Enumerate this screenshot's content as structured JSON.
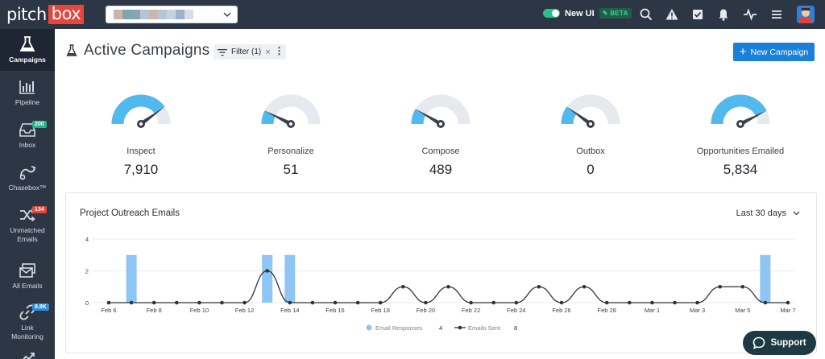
{
  "app": {
    "logo_part1": "pitch",
    "logo_part2": "box"
  },
  "header": {
    "new_ui_label": "New UI",
    "beta_label": "BETA",
    "project_swatches": [
      "#c9b6a8",
      "#7fa6ad",
      "#8aa3b8",
      "#b9c3d3",
      "#c8b8ae",
      "#b6c6d3",
      "#c5d2de",
      "#9fb1c6",
      "#d6dde6"
    ]
  },
  "sidebar": {
    "items": [
      {
        "label": "Campaigns",
        "icon": "flask-icon",
        "active": true
      },
      {
        "label": "Pipeline",
        "icon": "bar-chart-icon"
      },
      {
        "label": "Inbox",
        "icon": "inbox-icon",
        "badge": "200",
        "badge_color": "#27b48a"
      },
      {
        "label": "Chasebox™",
        "icon": "chasebox-icon"
      },
      {
        "label": "Unmatched Emails",
        "icon": "shuffle-icon",
        "badge": "134",
        "badge_color": "#e8453c"
      },
      {
        "label": "All Emails",
        "icon": "envelopes-icon"
      },
      {
        "label": "Link Monitoring",
        "icon": "link-icon",
        "badge": "8.8K",
        "badge_color": "#2e8fd8"
      }
    ]
  },
  "page": {
    "title": "Active Campaigns",
    "filter_label": "Filter (1)",
    "new_campaign_label": "New Campaign"
  },
  "gauges": [
    {
      "label": "Inspect",
      "value": "7,910",
      "level": 0.8
    },
    {
      "label": "Personalize",
      "value": "51",
      "level": 0.15
    },
    {
      "label": "Compose",
      "value": "489",
      "level": 0.17
    },
    {
      "label": "Outbox",
      "value": "0",
      "level": 0.2
    },
    {
      "label": "Opportunities Emailed",
      "value": "5,834",
      "level": 0.85
    }
  ],
  "outreach": {
    "title": "Project Outreach Emails",
    "range_label": "Last 30 days"
  },
  "chart_data": {
    "type": "bar",
    "title": "Project Outreach Emails",
    "x": [
      "Feb 6",
      "Feb 7",
      "Feb 8",
      "Feb 9",
      "Feb 10",
      "Feb 11",
      "Feb 12",
      "Feb 13",
      "Feb 14",
      "Feb 15",
      "Feb 16",
      "Feb 17",
      "Feb 18",
      "Feb 19",
      "Feb 20",
      "Feb 21",
      "Feb 22",
      "Feb 23",
      "Feb 24",
      "Feb 25",
      "Feb 26",
      "Feb 27",
      "Feb 28",
      "Feb 29",
      "Mar 1",
      "Mar 2",
      "Mar 3",
      "Mar 4",
      "Mar 5",
      "Mar 6",
      "Mar 7"
    ],
    "x_tick_labels": [
      "Feb 6",
      "Feb 8",
      "Feb 10",
      "Feb 12",
      "Feb 14",
      "Feb 16",
      "Feb 18",
      "Feb 20",
      "Feb 22",
      "Feb 24",
      "Feb 26",
      "Feb 28",
      "Mar 1",
      "Mar 3",
      "Mar 5",
      "Mar 7"
    ],
    "y_ticks": [
      "0",
      "2",
      "4"
    ],
    "ylim": [
      0,
      4
    ],
    "series": [
      {
        "name": "Email Responses",
        "kind": "bar",
        "color": "#8ec5f5",
        "total": "4",
        "values": [
          0,
          3,
          0,
          0,
          0,
          0,
          0,
          3,
          3,
          0,
          0,
          0,
          0,
          0,
          0,
          0,
          0,
          0,
          0,
          0,
          0,
          0,
          0,
          0,
          0,
          0,
          0,
          0,
          0,
          3,
          0
        ]
      },
      {
        "name": "Emails Sent",
        "kind": "line",
        "color": "#2f3338",
        "total": "8",
        "values": [
          0,
          0,
          0,
          0,
          0,
          0,
          0,
          2,
          0,
          0,
          0,
          0,
          0,
          1,
          0,
          1,
          0,
          0,
          0,
          1,
          0,
          1,
          0,
          0,
          0,
          0,
          0,
          1,
          1,
          0,
          0
        ]
      }
    ],
    "grid": true,
    "legend": "bottom"
  },
  "support": {
    "label": "Support"
  }
}
